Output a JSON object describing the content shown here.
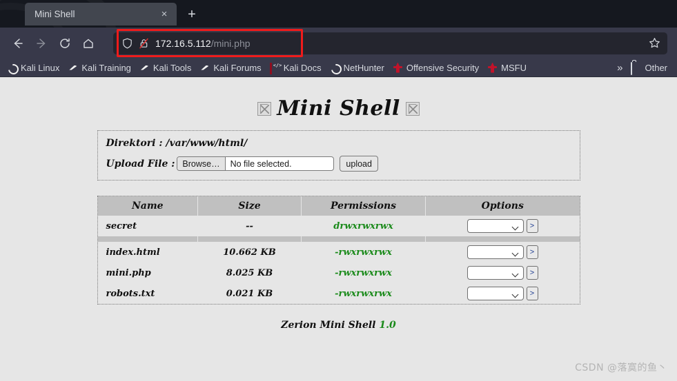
{
  "browser": {
    "tab": {
      "title": "Mini Shell",
      "close_label": "×",
      "newtab_label": "+"
    },
    "nav": {
      "back": "back-arrow",
      "forward": "forward-arrow",
      "reload": "reload-icon",
      "home": "home-icon"
    },
    "url": {
      "host": "172.16.5.112",
      "path": "/mini.php",
      "shield_icon": "shield-icon",
      "lock_icon": "broken-lock-icon",
      "star_icon": "star-icon"
    },
    "annotation": {
      "color": "#ef1b1b",
      "shape": "rectangle-around-urlbar"
    },
    "bookmarks": [
      {
        "label": "Kali Linux",
        "icon": "kali-dragon-icon"
      },
      {
        "label": "Kali Training",
        "icon": "kali-blue-icon"
      },
      {
        "label": "Kali Tools",
        "icon": "kali-blue-icon"
      },
      {
        "label": "Kali Forums",
        "icon": "kali-blue-icon"
      },
      {
        "label": "Kali Docs",
        "icon": "kali-book-icon"
      },
      {
        "label": "NetHunter",
        "icon": "kali-dragon-icon"
      },
      {
        "label": "Offensive Security",
        "icon": "sword-icon"
      },
      {
        "label": "MSFU",
        "icon": "sword-icon"
      }
    ],
    "overflow_label": "»",
    "other_bookmarks": {
      "label": "Other",
      "icon": "folder-icon"
    }
  },
  "page": {
    "title": "Mini Shell",
    "upload": {
      "dir_label": "Direktori : /var/www/html/",
      "file_label": "Upload File :",
      "browse_label": "Browse…",
      "file_status": "No file selected.",
      "upload_label": "upload"
    },
    "table": {
      "headers": [
        "Name",
        "Size",
        "Permissions",
        "Options"
      ],
      "dirs": [
        {
          "name": "secret",
          "size": "--",
          "perm": "drwxrwxrwx",
          "go": ">"
        }
      ],
      "files": [
        {
          "name": "index.html",
          "size": "10.662 KB",
          "perm": "-rwxrwxrwx",
          "go": ">"
        },
        {
          "name": "mini.php",
          "size": "8.025 KB",
          "perm": "-rwxrwxrwx",
          "go": ">"
        },
        {
          "name": "robots.txt",
          "size": "0.021 KB",
          "perm": "-rwxrwxrwx",
          "go": ">"
        }
      ]
    },
    "footer": {
      "text": "Zerion Mini Shell ",
      "version": "1.0"
    },
    "watermark": "CSDN @落寞的鱼丶",
    "colors": {
      "permission_green": "#1a8a1a",
      "header_gray": "#c0c0c0",
      "page_bg": "#e6e6e6"
    }
  }
}
